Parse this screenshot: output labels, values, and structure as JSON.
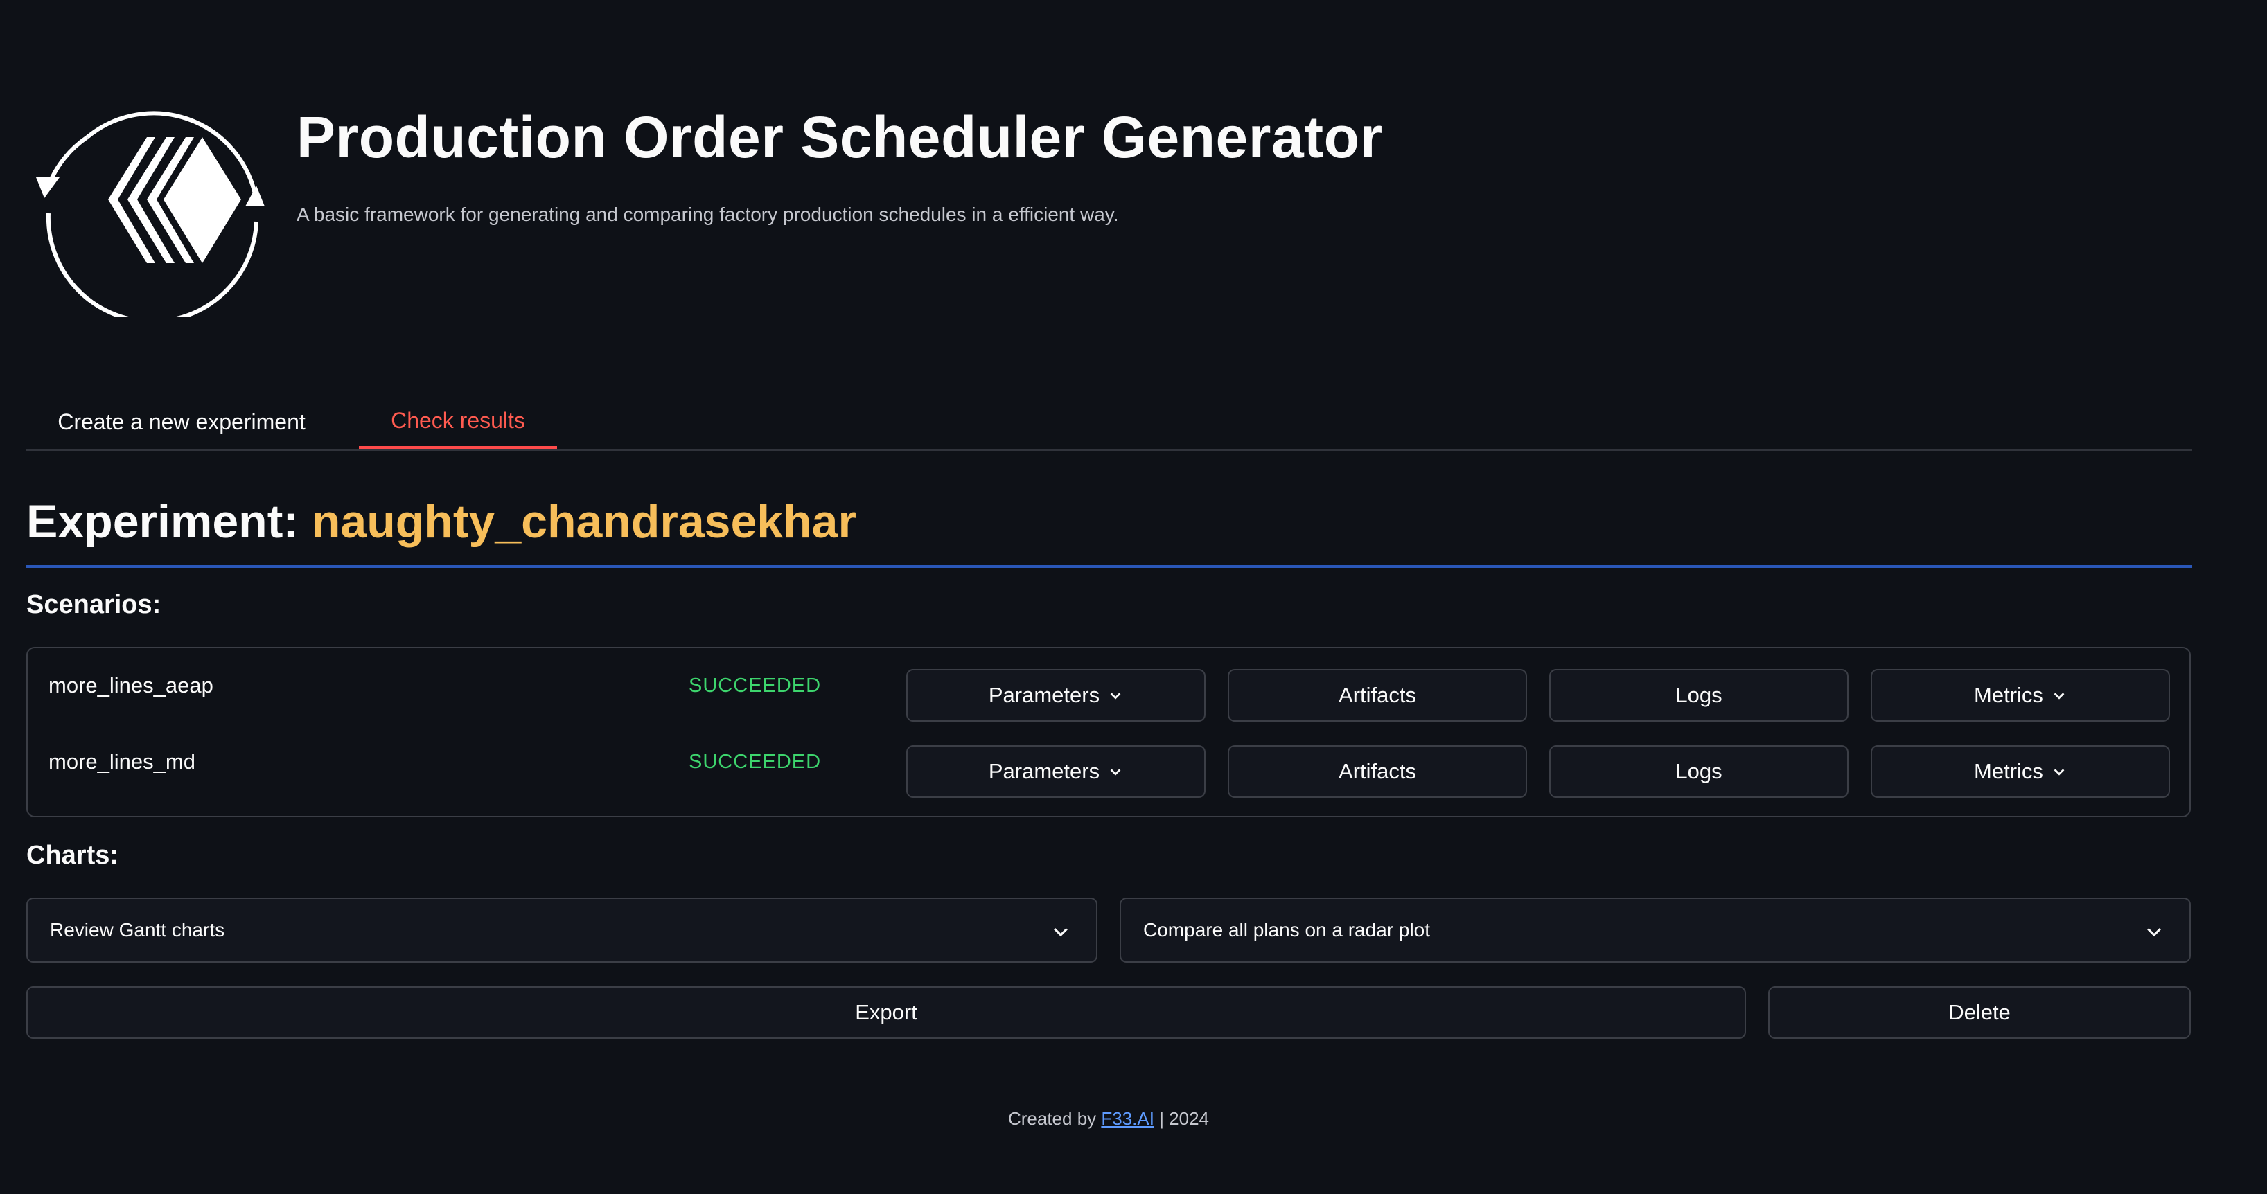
{
  "header": {
    "title": "Production Order Scheduler Generator",
    "subtitle": "A basic framework for generating and comparing factory production schedules in a efficient way."
  },
  "tabs": [
    {
      "label": "Create a new experiment",
      "active": false
    },
    {
      "label": "Check results",
      "active": true
    }
  ],
  "experiment": {
    "prefix": "Experiment: ",
    "name": "naughty_chandrasekhar"
  },
  "scenarios": {
    "label": "Scenarios:",
    "rows": [
      {
        "name": "more_lines_aeap",
        "status": "SUCCEEDED",
        "parameters_label": "Parameters",
        "artifacts_label": "Artifacts",
        "logs_label": "Logs",
        "metrics_label": "Metrics"
      },
      {
        "name": "more_lines_md",
        "status": "SUCCEEDED",
        "parameters_label": "Parameters",
        "artifacts_label": "Artifacts",
        "logs_label": "Logs",
        "metrics_label": "Metrics"
      }
    ]
  },
  "charts": {
    "label": "Charts:",
    "gantt_select": "Review Gantt charts",
    "radar_select": "Compare all plans on a radar plot"
  },
  "actions": {
    "export_label": "Export",
    "delete_label": "Delete"
  },
  "footer": {
    "prefix": "Created by ",
    "link": "F33.AI",
    "suffix": " | 2024"
  },
  "colors": {
    "background": "#0e1117",
    "accent": "#ff4b4b",
    "experiment_name": "#f7be5a",
    "success": "#3dd56d",
    "link": "#5e9bff"
  },
  "icons": [
    "app-logo",
    "chevron-down-icon"
  ]
}
